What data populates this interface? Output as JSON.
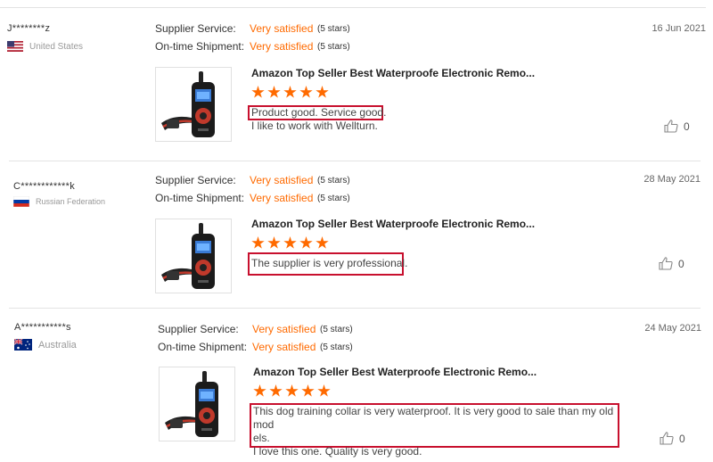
{
  "reviews": [
    {
      "user": "J********z",
      "country": "United States",
      "flag": "us",
      "supplier_label": "Supplier Service:",
      "supplier_value": "Very satisfied",
      "supplier_stars": "(5 stars)",
      "shipment_label": "On-time Shipment:",
      "shipment_value": "Very satisfied",
      "shipment_stars": "(5 stars)",
      "date": "16 Jun 2021",
      "product_title": "Amazon Top Seller Best Waterproofe Electronic Remo...",
      "product_rating": 5,
      "text_line1": "Product good. Service good.",
      "text_line2": "I like to work with Wellturn.",
      "likes": "0"
    },
    {
      "user": "C************k",
      "country": "Russian Federation",
      "flag": "ru",
      "supplier_label": "Supplier Service:",
      "supplier_value": "Very satisfied",
      "supplier_stars": "(5 stars)",
      "shipment_label": "On-time Shipment:",
      "shipment_value": "Very satisfied",
      "shipment_stars": "(5 stars)",
      "date": "28 May 2021",
      "product_title": "Amazon Top Seller Best Waterproofe Electronic Remo...",
      "product_rating": 5,
      "text_line1": "The supplier is very professional.",
      "likes": "0"
    },
    {
      "user": "A***********s",
      "country": "Australia",
      "flag": "au",
      "supplier_label": "Supplier Service:",
      "supplier_value": "Very satisfied",
      "supplier_stars": "(5 stars)",
      "shipment_label": "On-time Shipment:",
      "shipment_value": "Very satisfied",
      "shipment_stars": "(5 stars)",
      "date": "24 May 2021",
      "product_title": "Amazon Top Seller Best Waterproofe Electronic Remo...",
      "product_rating": 5,
      "text_line1": "This dog training collar is very waterproof. It is very good to sale than my old mod",
      "text_line2": "els.",
      "text_line3": "I love this one. Quality is very good.",
      "likes": "0"
    }
  ],
  "colors": {
    "accent": "#ff6a00",
    "highlight": "#c8102e"
  },
  "icons": {
    "like": "thumbs-up-icon"
  }
}
